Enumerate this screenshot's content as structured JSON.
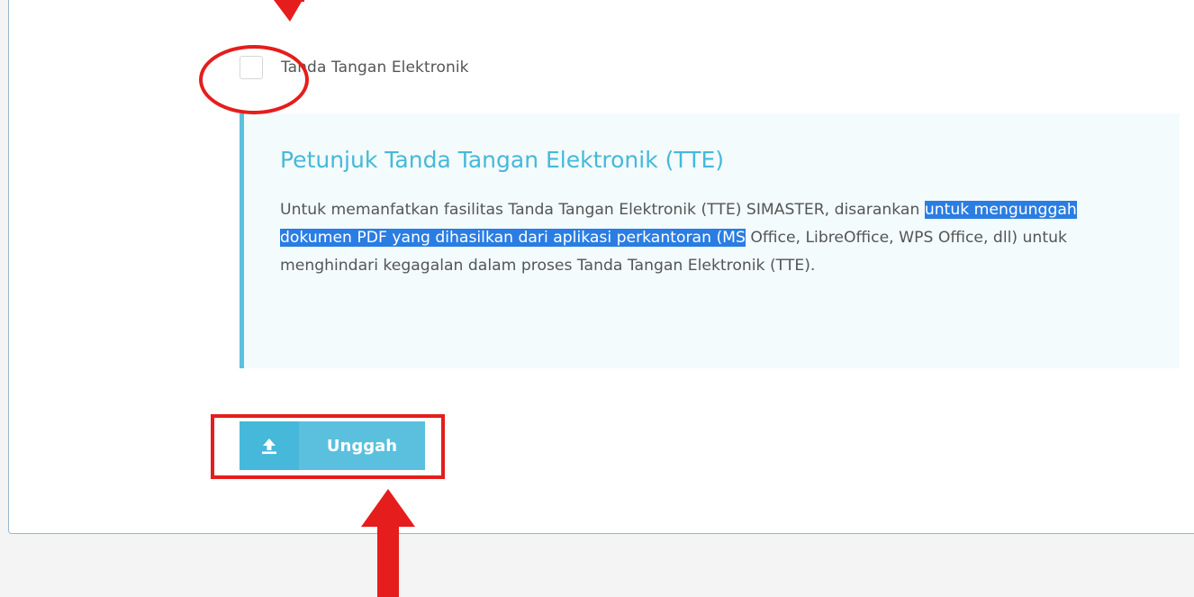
{
  "checkbox": {
    "label": "Tanda Tangan Elektronik",
    "checked": false
  },
  "callout": {
    "title": "Petunjuk Tanda Tangan Elektronik (TTE)",
    "text_before": "Untuk memanfatkan fasilitas Tanda Tangan Elektronik (TTE) SIMASTER, disarankan ",
    "text_highlighted": "untuk mengunggah dokumen PDF yang dihasilkan dari aplikasi perkantoran (MS",
    "text_after": " Office, LibreOffice, WPS Office, dll) untuk menghindari kegagalan dalam proses Tanda Tangan Elektronik (TTE)."
  },
  "upload_button": {
    "label": "Unggah",
    "icon": "upload-icon"
  },
  "colors": {
    "info": "#5bc0de",
    "info_dark": "#46b8da",
    "annotation": "#e51d1d",
    "selection": "#2a7de2"
  }
}
